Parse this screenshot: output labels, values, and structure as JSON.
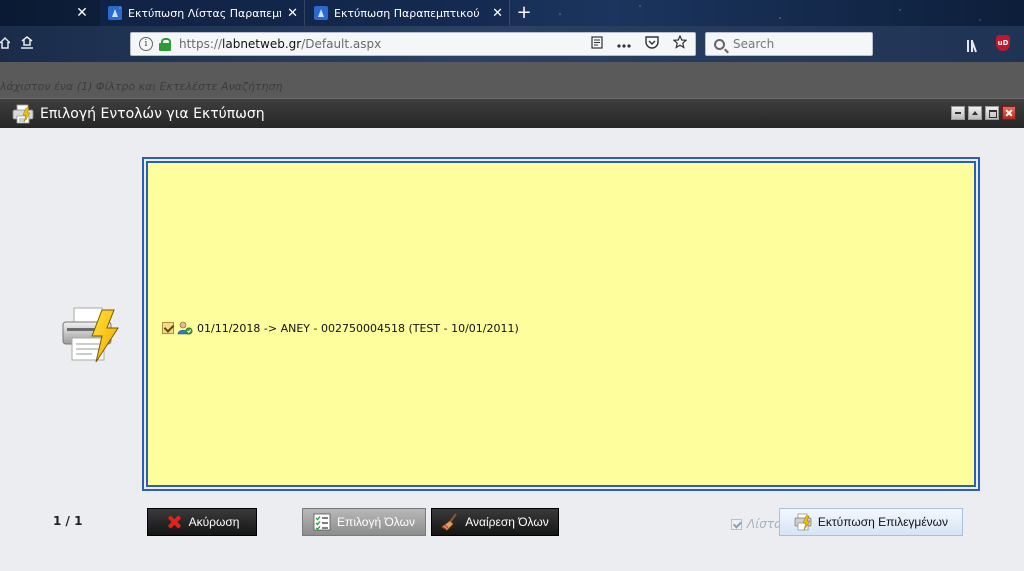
{
  "browser": {
    "tabs": [
      {
        "title": "Εκτύπωση Λίστας Παραπεμπτ"
      },
      {
        "title": "Εκτύπωση Παραπεμπτικού"
      }
    ],
    "new_tab_label": "+",
    "close_glyph": "✕",
    "url": {
      "protocol": "https://",
      "host": "labnetweb.gr",
      "path": "/Default.aspx"
    },
    "search_placeholder": "Search",
    "ublock_label": "uD"
  },
  "page": {
    "hint_text": "λάχιστον ένα (1) Φίλτρο και Εκτελέστε Αναζήτηση"
  },
  "dialog": {
    "title": "Επιλογή Εντολών για Εκτύπωση",
    "items": [
      {
        "label": "01/11/2018 -> ΑΝΕΥ - 002750004518 (TEST - 10/01/2011)",
        "checked": true
      }
    ],
    "pager": "1 / 1",
    "buttons": {
      "cancel": "Ακύρωση",
      "select_all": "Επιλογή Όλων",
      "deselect_all": "Αναίρεση Όλων",
      "print_selected": "Εκτύπωση Επιλεγμένων"
    },
    "list_checkbox_label": "Λίστα"
  },
  "colors": {
    "list_background": "#fffe9c",
    "list_border": "#2c5fb0",
    "title_bar": "#2e2e2e",
    "cancel_icon": "#e2231a"
  },
  "icons": {
    "tab_close": "close-icon",
    "back": "home-icon",
    "bookmark": "star-icon",
    "reader": "reader-view-icon",
    "pocket": "pocket-icon",
    "printer": "printer-icon",
    "lightning": "lightning-icon"
  }
}
